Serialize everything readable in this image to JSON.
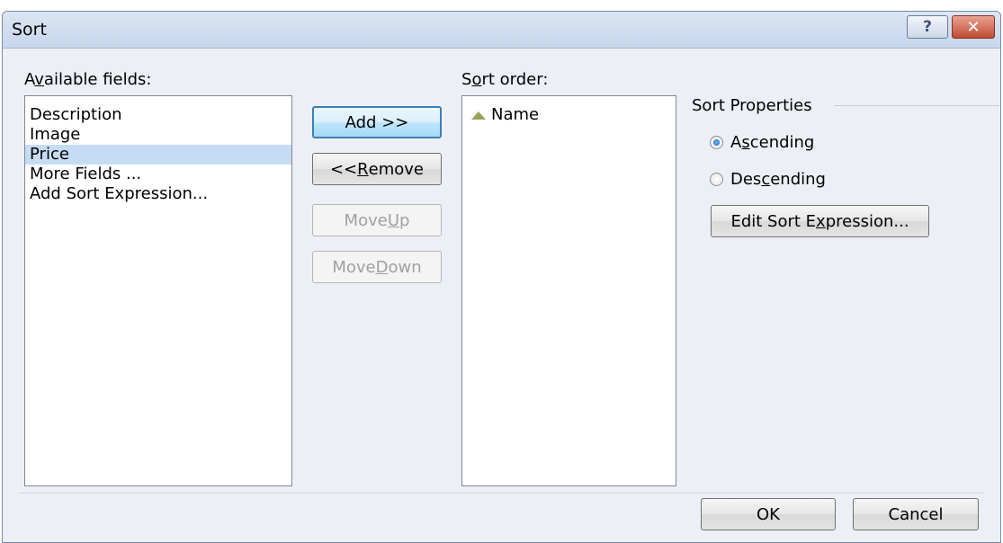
{
  "window": {
    "title": "Sort",
    "help_label": "?",
    "close_label": "✕"
  },
  "available": {
    "label_pre": "A",
    "label_ul": "v",
    "label_post": "ailable fields:",
    "items": [
      "Description",
      "Image",
      "Price",
      "More Fields ...",
      "Add Sort Expression..."
    ],
    "selected_index": 2
  },
  "buttons": {
    "add": "Add >>",
    "remove_pre": "<< ",
    "remove_ul": "R",
    "remove_post": "emove",
    "move_up_pre": "Move ",
    "move_up_ul": "U",
    "move_up_post": "p",
    "move_down_pre": "Move ",
    "move_down_ul": "D",
    "move_down_post": "own"
  },
  "sort_order": {
    "label_pre": "S",
    "label_ul": "o",
    "label_post": "rt order:",
    "items": [
      "Name"
    ]
  },
  "properties": {
    "title": "Sort Properties",
    "ascending_pre": "A",
    "ascending_ul": "s",
    "ascending_post": "cending",
    "descending_pre": "Des",
    "descending_ul": "c",
    "descending_post": "ending",
    "selected": "Ascending",
    "edit_pre": "Edit Sort E",
    "edit_ul": "x",
    "edit_post": "pression..."
  },
  "footer": {
    "ok": "OK",
    "cancel": "Cancel"
  },
  "colors": {
    "selection": "#c6dcf5",
    "dialog_bg": "#ecf0f6"
  }
}
